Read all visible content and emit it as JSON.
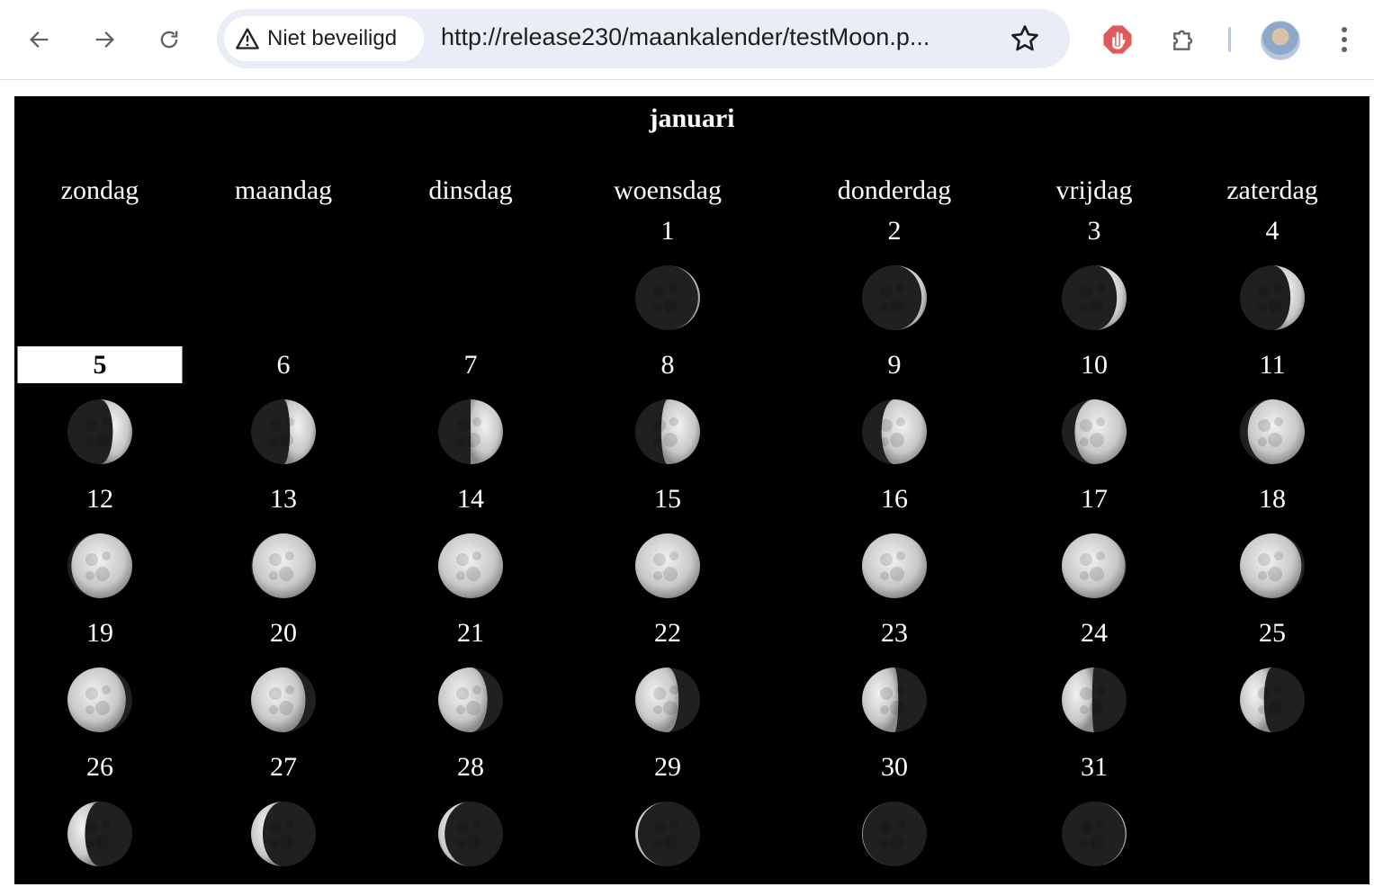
{
  "browser": {
    "security_label": "Niet beveiligd",
    "url": "http://release230/maankalender/testMoon.p...",
    "icons": [
      "back-arrow-icon",
      "forward-arrow-icon",
      "reload-icon",
      "warning-triangle-icon",
      "bookmark-star-icon",
      "stop-hand-extension-icon",
      "puzzle-extensions-icon",
      "avatar",
      "kebab-menu-icon"
    ]
  },
  "calendar": {
    "month": "januari",
    "weekdays": [
      "zondag",
      "maandag",
      "dinsdag",
      "woensdag",
      "donderdag",
      "vrijdag",
      "zaterdag"
    ],
    "first_weekday_index": 3,
    "today": "5",
    "days": [
      "1",
      "2",
      "3",
      "4",
      "5",
      "6",
      "7",
      "8",
      "9",
      "10",
      "11",
      "12",
      "13",
      "14",
      "15",
      "16",
      "17",
      "18",
      "19",
      "20",
      "21",
      "22",
      "23",
      "24",
      "25",
      "26",
      "27",
      "28",
      "29",
      "30",
      "31"
    ],
    "moon_illumination": [
      0.03,
      0.08,
      0.15,
      0.22,
      0.3,
      0.4,
      0.5,
      0.6,
      0.7,
      0.8,
      0.88,
      0.94,
      0.98,
      1.0,
      1.0,
      1.0,
      0.98,
      0.95,
      0.9,
      0.84,
      0.76,
      0.67,
      0.56,
      0.47,
      0.37,
      0.27,
      0.18,
      0.1,
      0.04,
      0.01,
      0.02
    ],
    "moon_waxing": [
      true,
      true,
      true,
      true,
      true,
      true,
      true,
      true,
      true,
      true,
      true,
      true,
      true,
      true,
      true,
      true,
      false,
      false,
      false,
      false,
      false,
      false,
      false,
      false,
      false,
      false,
      false,
      false,
      false,
      false,
      true
    ],
    "colors": {
      "background": "#000000",
      "text": "#ffffff",
      "today_bg": "#ffffff",
      "today_text": "#000000"
    }
  }
}
